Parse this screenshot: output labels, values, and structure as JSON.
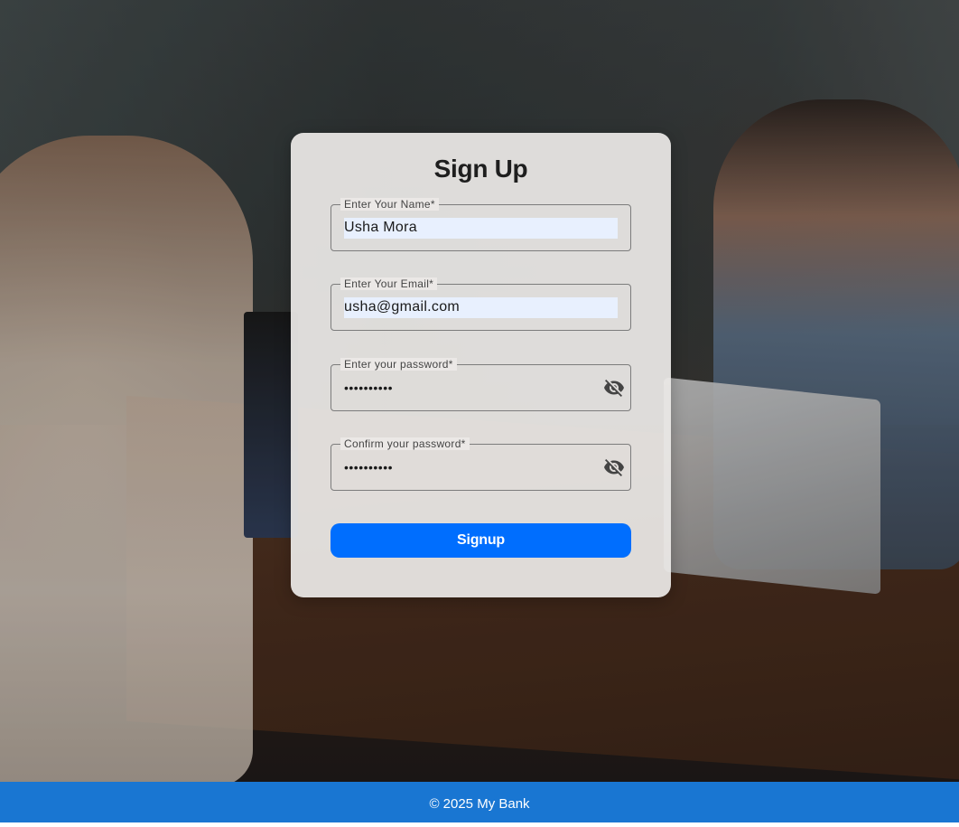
{
  "form": {
    "title": "Sign Up",
    "name_label": "Enter Your Name*",
    "name_value": "Usha Mora",
    "email_label": "Enter Your Email*",
    "email_value": "usha@gmail.com",
    "password_label": "Enter your password*",
    "password_value": "••••••••••",
    "confirm_label": "Confirm your password*",
    "confirm_value": "••••••••••",
    "password_toggle_icon": "visibility-off-icon",
    "confirm_toggle_icon": "visibility-off-icon",
    "submit_label": "Signup"
  },
  "footer": {
    "text": "© 2025 My Bank"
  },
  "colors": {
    "primary_button": "#006efe",
    "footer_bg": "#1976d2",
    "autofill_bg": "#e8f0fe"
  }
}
